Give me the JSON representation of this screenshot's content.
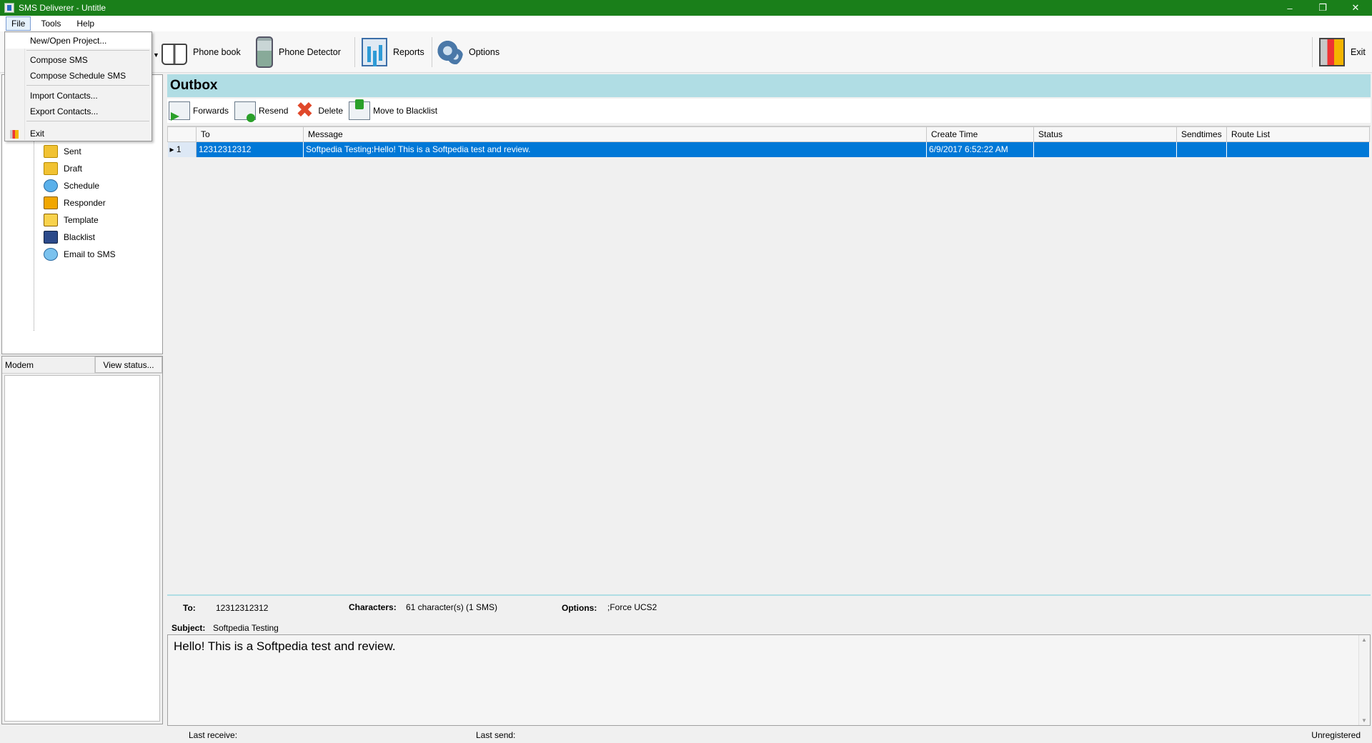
{
  "window": {
    "title": "SMS Deliverer - Untitle",
    "minimize": "–",
    "restore": "❐",
    "close": "✕"
  },
  "menubar": {
    "file": "File",
    "tools": "Tools",
    "help": "Help"
  },
  "file_menu": {
    "items": [
      "New/Open Project...",
      "Compose SMS",
      "Compose Schedule SMS",
      "Import Contacts...",
      "Export Contacts...",
      "Exit"
    ]
  },
  "toolbar": {
    "phonebook": "Phone book",
    "phone_detector": "Phone Detector",
    "reports": "Reports",
    "options": "Options",
    "exit": "Exit"
  },
  "nav_tree": {
    "items": [
      "Sent",
      "Draft",
      "Schedule",
      "Responder",
      "Template",
      "Blacklist",
      "Email to SMS"
    ]
  },
  "modem": {
    "column": "Modem",
    "view_status": "View status..."
  },
  "outbox": {
    "title": "Outbox",
    "actions": {
      "forwards": "Forwards",
      "resend": "Resend",
      "delete": "Delete",
      "move_to_blacklist": "Move to Blacklist"
    },
    "columns": [
      "To",
      "Message",
      "Create Time",
      "Status",
      "Sendtimes",
      "Route List"
    ],
    "rows": [
      {
        "index": "1",
        "to": "12312312312",
        "message": "Softpedia Testing:Hello! This is a Softpedia test and review.",
        "create_time": "6/9/2017 6:52:22 AM",
        "status": "",
        "sendtimes": "",
        "route_list": ""
      }
    ]
  },
  "detail": {
    "to_label": "To:",
    "to_value": "12312312312",
    "characters_label": "Characters:",
    "characters_value": "61 character(s) (1 SMS)",
    "options_label": "Options:",
    "options_value": ";Force UCS2",
    "subject_label": "Subject:",
    "subject_value": "Softpedia Testing",
    "body": "Hello! This is a Softpedia test and review."
  },
  "statusbar": {
    "last_receive": "Last receive:",
    "last_send": "Last send:",
    "registration": "Unregistered"
  },
  "colors": {
    "titlebar": "#1a7f1a",
    "outbox_header": "#b0dde4",
    "selection": "#0078d7"
  }
}
